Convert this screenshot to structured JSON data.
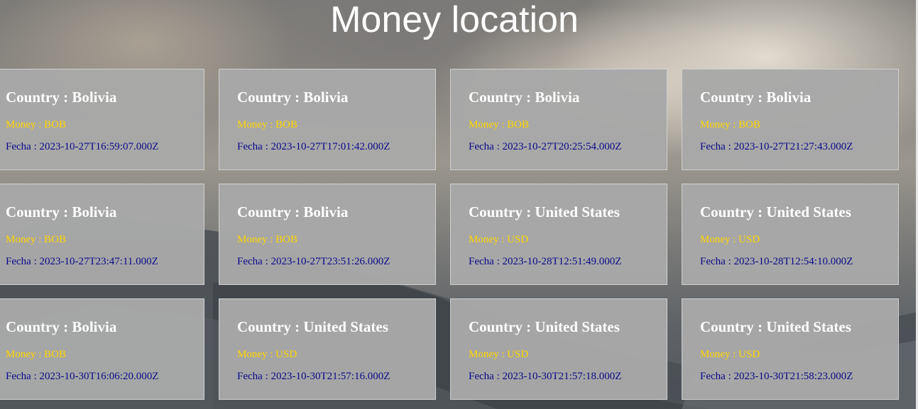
{
  "page": {
    "title": "Money location"
  },
  "labels": {
    "country_prefix": "Country : ",
    "money_prefix": "Money : ",
    "fecha_prefix": "Fecha : "
  },
  "colors": {
    "card_bg": "#a8a8a8",
    "country_text": "#ffffff",
    "money_text": "#ffd700",
    "fecha_text": "#0a0a8a",
    "title_text": "#ffffff"
  },
  "cards": [
    {
      "country": "Country : Bolivia",
      "money": "Money : BOB",
      "fecha": "Fecha : 2023-10-27T16:59:07.000Z"
    },
    {
      "country": "Country : Bolivia",
      "money": "Money : BOB",
      "fecha": "Fecha : 2023-10-27T17:01:42.000Z"
    },
    {
      "country": "Country : Bolivia",
      "money": "Money : BOB",
      "fecha": "Fecha : 2023-10-27T20:25:54.000Z"
    },
    {
      "country": "Country : Bolivia",
      "money": "Money : BOB",
      "fecha": "Fecha : 2023-10-27T21:27:43.000Z"
    },
    {
      "country": "Country : Bolivia",
      "money": "Money : BOB",
      "fecha": "Fecha : 2023-10-27T23:47:11.000Z"
    },
    {
      "country": "Country : Bolivia",
      "money": "Money : BOB",
      "fecha": "Fecha : 2023-10-27T23:51:26.000Z"
    },
    {
      "country": "Country : United States",
      "money": "Money : USD",
      "fecha": "Fecha : 2023-10-28T12:51:49.000Z"
    },
    {
      "country": "Country : United States",
      "money": "Money : USD",
      "fecha": "Fecha : 2023-10-28T12:54:10.000Z"
    },
    {
      "country": "Country : Bolivia",
      "money": "Money : BOB",
      "fecha": "Fecha : 2023-10-30T16:06:20.000Z"
    },
    {
      "country": "Country : United States",
      "money": "Money : USD",
      "fecha": "Fecha : 2023-10-30T21:57:16.000Z"
    },
    {
      "country": "Country : United States",
      "money": "Money : USD",
      "fecha": "Fecha : 2023-10-30T21:57:18.000Z"
    },
    {
      "country": "Country : United States",
      "money": "Money : USD",
      "fecha": "Fecha : 2023-10-30T21:58:23.000Z"
    }
  ]
}
